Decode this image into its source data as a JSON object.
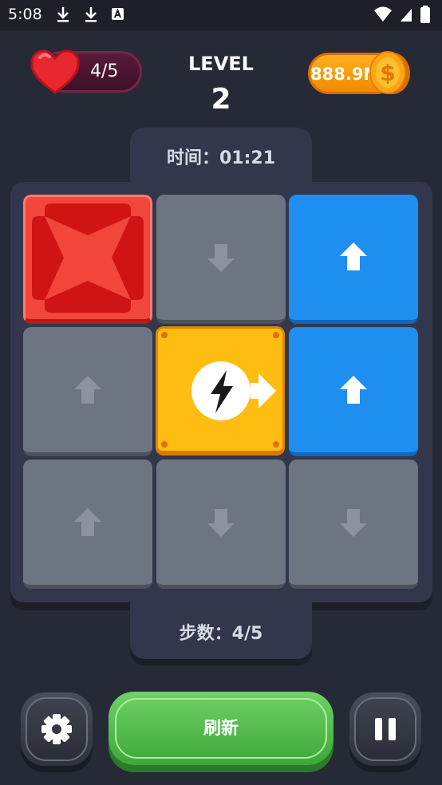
{
  "status_bar": {
    "time": "5:08"
  },
  "header": {
    "hearts": "4/5",
    "level_label": "LEVEL",
    "level_number": "2",
    "coins": "888.9M"
  },
  "timer": {
    "text": "时间：01:21"
  },
  "board": {
    "tiles": [
      {
        "row": 0,
        "col": 0,
        "type": "red-cross"
      },
      {
        "row": 0,
        "col": 1,
        "type": "gray",
        "arrow": "down"
      },
      {
        "row": 0,
        "col": 2,
        "type": "blue",
        "arrow": "up"
      },
      {
        "row": 1,
        "col": 0,
        "type": "gray",
        "arrow": "up"
      },
      {
        "row": 1,
        "col": 1,
        "type": "yellow-bolt",
        "arrow": "right"
      },
      {
        "row": 1,
        "col": 2,
        "type": "blue",
        "arrow": "up"
      },
      {
        "row": 2,
        "col": 0,
        "type": "gray",
        "arrow": "up"
      },
      {
        "row": 2,
        "col": 1,
        "type": "gray",
        "arrow": "down"
      },
      {
        "row": 2,
        "col": 2,
        "type": "gray",
        "arrow": "down"
      }
    ]
  },
  "steps": {
    "text": "步数：4/5"
  },
  "buttons": {
    "refresh_label": "刷新",
    "settings_icon": "gear-icon",
    "pause_icon": "pause-icon"
  },
  "colors": {
    "background": "#262936",
    "panel": "#33374b",
    "gray_tile": "#6e7582",
    "blue_tile": "#1e8ff0",
    "red_tile": "#f2463a",
    "yellow_tile": "#ffbd12",
    "green_button": "#4fbf48"
  }
}
